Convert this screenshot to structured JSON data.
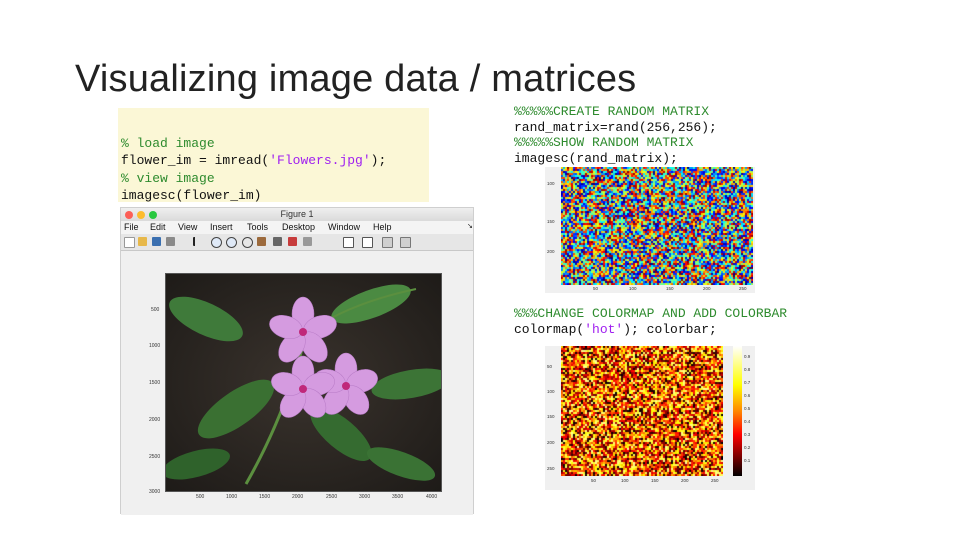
{
  "slide": {
    "title": "Visualizing image data / matrices"
  },
  "left_code": [
    {
      "kind": "comment",
      "text": "% load image"
    },
    {
      "kind": "code",
      "prefix": "flower_im = imread(",
      "str": "'Flowers.jpg'",
      "suffix": ");"
    },
    {
      "kind": "comment",
      "text": "% view image"
    },
    {
      "kind": "code",
      "prefix": "imagesc(flower_im)",
      "str": "",
      "suffix": ""
    }
  ],
  "right_code_1": [
    {
      "kind": "comment",
      "text": "%%%%%CREATE RANDOM MATRIX"
    },
    {
      "kind": "code",
      "text": "rand_matrix=rand(256,256);"
    },
    {
      "kind": "comment",
      "text": "%%%%%SHOW RANDOM MATRIX"
    },
    {
      "kind": "code",
      "text": "imagesc(rand_matrix);"
    }
  ],
  "right_code_2": [
    {
      "kind": "comment",
      "text": "%%%CHANGE COLORMAP AND ADD COLORBAR"
    },
    {
      "kind": "code",
      "prefix": "colormap(",
      "str": "'hot'",
      "suffix": "); colorbar;"
    }
  ],
  "figure": {
    "title": "Figure 1",
    "menus": [
      "File",
      "Edit",
      "View",
      "Insert",
      "Tools",
      "Desktop",
      "Window",
      "Help"
    ],
    "yticks": [
      "500",
      "1000",
      "1500",
      "2000",
      "2500",
      "3000"
    ],
    "xticks": [
      "500",
      "1000",
      "1500",
      "2000",
      "2500",
      "3000",
      "3500",
      "4000"
    ]
  },
  "rand_plot_1": {
    "yticks": [
      "100",
      "150",
      "200"
    ],
    "xticks": [
      "50",
      "100",
      "150",
      "200",
      "250"
    ]
  },
  "rand_plot_2": {
    "yticks": [
      "50",
      "100",
      "150",
      "200",
      "250"
    ],
    "xticks": [
      "50",
      "100",
      "150",
      "200",
      "250"
    ],
    "colorbar_ticks": [
      "0.9",
      "0.8",
      "0.7",
      "0.6",
      "0.5",
      "0.4",
      "0.3",
      "0.2",
      "0.1"
    ]
  },
  "colors": {
    "comment": "#2e8b2e",
    "string": "#a020f0",
    "code_bg": "#fbf7d6",
    "mac_close": "#fc5f57",
    "mac_min": "#fdbc2e",
    "mac_max": "#28c840"
  }
}
